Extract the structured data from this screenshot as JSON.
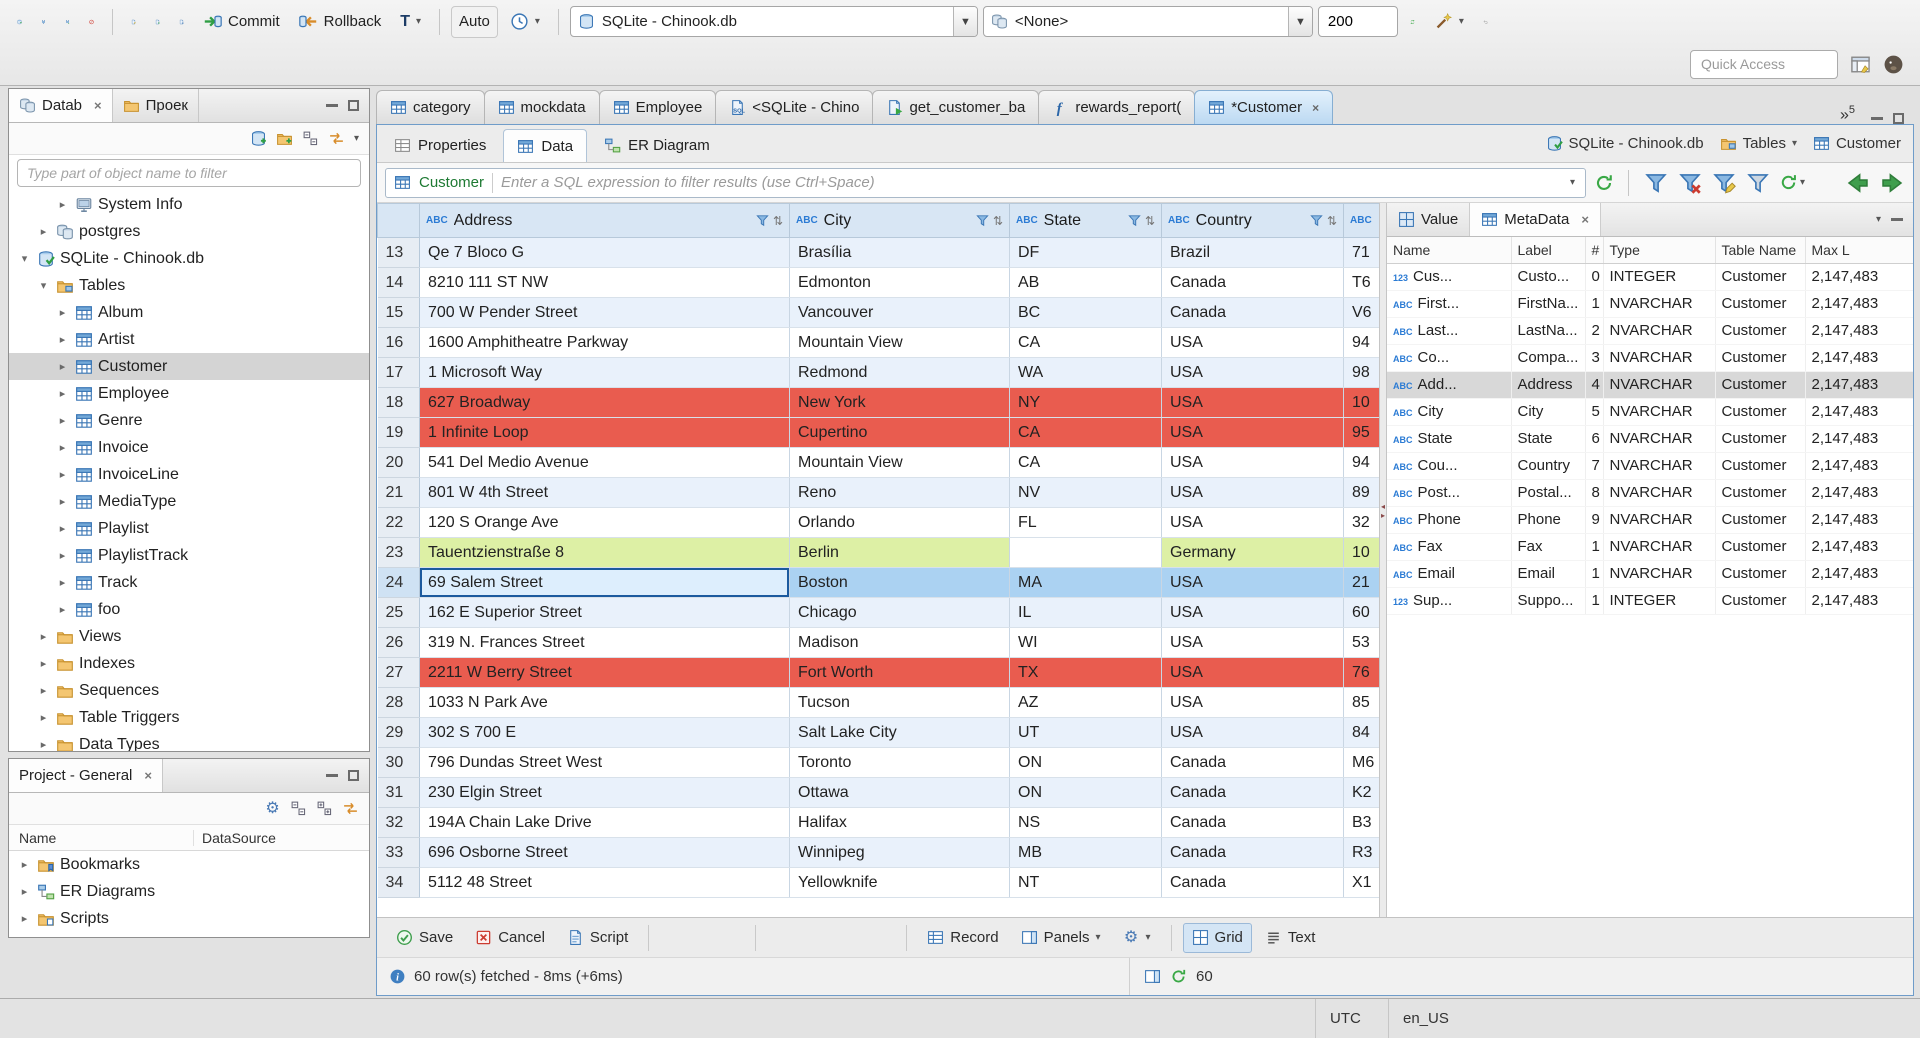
{
  "window": {
    "statusbar": {
      "timezone": "UTC",
      "locale": "en_US"
    }
  },
  "toolbar": {
    "commit_label": "Commit",
    "rollback_label": "Rollback",
    "txn_letter": "T",
    "auto_label": "Auto",
    "connection_value": "SQLite - Chinook.db",
    "schema_value": "<None>",
    "fetch_size_value": "200",
    "quick_access_placeholder": "Quick Access"
  },
  "navigator": {
    "tabs": [
      {
        "label": "Datab"
      },
      {
        "label": "Проек"
      }
    ],
    "filter_placeholder": "Type part of object name to filter",
    "tree": [
      {
        "label": "System Info",
        "icon": "server-icon",
        "indent": 2,
        "arrow": "collapsed"
      },
      {
        "label": "postgres",
        "icon": "db-multi-icon",
        "indent": 1,
        "arrow": "collapsed"
      },
      {
        "label": "SQLite - Chinook.db",
        "icon": "db-connected-icon",
        "indent": 0,
        "arrow": "expanded"
      },
      {
        "label": "Tables",
        "icon": "folder-tables-icon",
        "indent": 1,
        "arrow": "expanded"
      },
      {
        "label": "Album",
        "icon": "table-icon",
        "indent": 2,
        "arrow": "collapsed"
      },
      {
        "label": "Artist",
        "icon": "table-icon",
        "indent": 2,
        "arrow": "collapsed"
      },
      {
        "label": "Customer",
        "icon": "table-icon",
        "indent": 2,
        "arrow": "collapsed",
        "selected": true
      },
      {
        "label": "Employee",
        "icon": "table-icon",
        "indent": 2,
        "arrow": "collapsed"
      },
      {
        "label": "Genre",
        "icon": "table-icon",
        "indent": 2,
        "arrow": "collapsed"
      },
      {
        "label": "Invoice",
        "icon": "table-icon",
        "indent": 2,
        "arrow": "collapsed"
      },
      {
        "label": "InvoiceLine",
        "icon": "table-icon",
        "indent": 2,
        "arrow": "collapsed"
      },
      {
        "label": "MediaType",
        "icon": "table-icon",
        "indent": 2,
        "arrow": "collapsed"
      },
      {
        "label": "Playlist",
        "icon": "table-icon",
        "indent": 2,
        "arrow": "collapsed"
      },
      {
        "label": "PlaylistTrack",
        "icon": "table-icon",
        "indent": 2,
        "arrow": "collapsed"
      },
      {
        "label": "Track",
        "icon": "table-icon",
        "indent": 2,
        "arrow": "collapsed"
      },
      {
        "label": "foo",
        "icon": "table-icon",
        "indent": 2,
        "arrow": "collapsed"
      },
      {
        "label": "Views",
        "icon": "folder-icon",
        "indent": 1,
        "arrow": "collapsed"
      },
      {
        "label": "Indexes",
        "icon": "folder-icon",
        "indent": 1,
        "arrow": "collapsed"
      },
      {
        "label": "Sequences",
        "icon": "folder-icon",
        "indent": 1,
        "arrow": "collapsed"
      },
      {
        "label": "Table Triggers",
        "icon": "folder-icon",
        "indent": 1,
        "arrow": "collapsed"
      },
      {
        "label": "Data Types",
        "icon": "folder-icon",
        "indent": 1,
        "arrow": "collapsed"
      }
    ]
  },
  "project": {
    "title": "Project - General",
    "columns": [
      "Name",
      "DataSource"
    ],
    "items": [
      {
        "label": "Bookmarks",
        "icon": "folder-bookmarks-icon"
      },
      {
        "label": "ER Diagrams",
        "icon": "er-diagrams-icon"
      },
      {
        "label": "Scripts",
        "icon": "folder-scripts-icon"
      }
    ]
  },
  "editor_tabs": {
    "overflow_count": "5",
    "tabs": [
      {
        "label": "category",
        "icon": "table-icon"
      },
      {
        "label": "mockdata",
        "icon": "table-icon"
      },
      {
        "label": "Employee",
        "icon": "table-icon"
      },
      {
        "label": "<SQLite - Chino",
        "icon": "sql-icon"
      },
      {
        "label": "get_customer_ba",
        "icon": "sql-exec-icon"
      },
      {
        "label": "rewards_report(",
        "icon": "function-icon"
      },
      {
        "label": "*Customer",
        "icon": "table-icon",
        "active": true,
        "closable": true
      }
    ]
  },
  "result_tabs": [
    {
      "label": "Properties"
    },
    {
      "label": "Data"
    },
    {
      "label": "ER Diagram"
    }
  ],
  "context_bar": {
    "connection": "SQLite - Chinook.db",
    "container": "Tables",
    "entity": "Customer"
  },
  "filter": {
    "table_label": "Customer",
    "placeholder": "Enter a SQL expression to filter results (use Ctrl+Space)"
  },
  "grid": {
    "columns": [
      {
        "label": "Address",
        "type_icon": "ABC"
      },
      {
        "label": "City",
        "type_icon": "ABC"
      },
      {
        "label": "State",
        "type_icon": "ABC"
      },
      {
        "label": "Country",
        "type_icon": "ABC"
      },
      {
        "label": "",
        "type_icon": "ABC"
      }
    ],
    "rows": [
      {
        "num": "13",
        "cells": [
          "Qe 7 Bloco G",
          "Brasília",
          "DF",
          "Brazil",
          "71"
        ]
      },
      {
        "num": "14",
        "cells": [
          "8210 111 ST NW",
          "Edmonton",
          "AB",
          "Canada",
          "T6"
        ]
      },
      {
        "num": "15",
        "cells": [
          "700 W Pender Street",
          "Vancouver",
          "BC",
          "Canada",
          "V6"
        ]
      },
      {
        "num": "16",
        "cells": [
          "1600 Amphitheatre Parkway",
          "Mountain View",
          "CA",
          "USA",
          "94"
        ]
      },
      {
        "num": "17",
        "cells": [
          "1 Microsoft Way",
          "Redmond",
          "WA",
          "USA",
          "98"
        ]
      },
      {
        "num": "18",
        "hl": "red",
        "cells": [
          "627 Broadway",
          "New York",
          "NY",
          "USA",
          "10"
        ]
      },
      {
        "num": "19",
        "hl": "red",
        "cells": [
          "1 Infinite Loop",
          "Cupertino",
          "CA",
          "USA",
          "95"
        ]
      },
      {
        "num": "20",
        "cells": [
          "541 Del Medio Avenue",
          "Mountain View",
          "CA",
          "USA",
          "94"
        ]
      },
      {
        "num": "21",
        "cells": [
          "801 W 4th Street",
          "Reno",
          "NV",
          "USA",
          "89"
        ]
      },
      {
        "num": "22",
        "cells": [
          "120 S Orange Ave",
          "Orlando",
          "FL",
          "USA",
          "32"
        ]
      },
      {
        "num": "23",
        "hl": "green",
        "cells": [
          "Tauentzienstraße 8",
          "Berlin",
          "",
          "Germany",
          "10"
        ]
      },
      {
        "num": "24",
        "hl": "selected",
        "focus_col": 0,
        "cells": [
          "69 Salem Street",
          "Boston",
          "MA",
          "USA",
          "21"
        ]
      },
      {
        "num": "25",
        "cells": [
          "162 E Superior Street",
          "Chicago",
          "IL",
          "USA",
          "60"
        ]
      },
      {
        "num": "26",
        "cells": [
          "319 N. Frances Street",
          "Madison",
          "WI",
          "USA",
          "53"
        ]
      },
      {
        "num": "27",
        "hl": "red",
        "cells": [
          "2211 W Berry Street",
          "Fort Worth",
          "TX",
          "USA",
          "76"
        ]
      },
      {
        "num": "28",
        "cells": [
          "1033 N Park Ave",
          "Tucson",
          "AZ",
          "USA",
          "85"
        ]
      },
      {
        "num": "29",
        "cells": [
          "302 S 700 E",
          "Salt Lake City",
          "UT",
          "USA",
          "84"
        ]
      },
      {
        "num": "30",
        "cells": [
          "796 Dundas Street West",
          "Toronto",
          "ON",
          "Canada",
          "M6"
        ]
      },
      {
        "num": "31",
        "cells": [
          "230 Elgin Street",
          "Ottawa",
          "ON",
          "Canada",
          "K2"
        ]
      },
      {
        "num": "32",
        "cells": [
          "194A Chain Lake Drive",
          "Halifax",
          "NS",
          "Canada",
          "B3"
        ]
      },
      {
        "num": "33",
        "cells": [
          "696 Osborne Street",
          "Winnipeg",
          "MB",
          "Canada",
          "R3"
        ]
      },
      {
        "num": "34",
        "cells": [
          "5112 48 Street",
          "Yellowknife",
          "NT",
          "Canada",
          "X1"
        ]
      }
    ]
  },
  "panel": {
    "tabs": [
      {
        "label": "Value"
      },
      {
        "label": "MetaData"
      }
    ],
    "columns": [
      "Name",
      "Label",
      "#",
      "Type",
      "Table Name",
      "Max L"
    ],
    "rows": [
      {
        "icon": "123",
        "name": "Cus...",
        "label": "Custo...",
        "num": "0",
        "type": "INTEGER",
        "table": "Customer",
        "max": "2,147,483"
      },
      {
        "icon": "ABC",
        "name": "First...",
        "label": "FirstNa...",
        "num": "1",
        "type": "NVARCHAR",
        "table": "Customer",
        "max": "2,147,483"
      },
      {
        "icon": "ABC",
        "name": "Last...",
        "label": "LastNa...",
        "num": "2",
        "type": "NVARCHAR",
        "table": "Customer",
        "max": "2,147,483"
      },
      {
        "icon": "ABC",
        "name": "Co...",
        "label": "Compa...",
        "num": "3",
        "type": "NVARCHAR",
        "table": "Customer",
        "max": "2,147,483"
      },
      {
        "icon": "ABC",
        "name": "Add...",
        "label": "Address",
        "num": "4",
        "type": "NVARCHAR",
        "table": "Customer",
        "max": "2,147,483",
        "selected": true
      },
      {
        "icon": "ABC",
        "name": "City",
        "label": "City",
        "num": "5",
        "type": "NVARCHAR",
        "table": "Customer",
        "max": "2,147,483"
      },
      {
        "icon": "ABC",
        "name": "State",
        "label": "State",
        "num": "6",
        "type": "NVARCHAR",
        "table": "Customer",
        "max": "2,147,483"
      },
      {
        "icon": "ABC",
        "name": "Cou...",
        "label": "Country",
        "num": "7",
        "type": "NVARCHAR",
        "table": "Customer",
        "max": "2,147,483"
      },
      {
        "icon": "ABC",
        "name": "Post...",
        "label": "Postal...",
        "num": "8",
        "type": "NVARCHAR",
        "table": "Customer",
        "max": "2,147,483"
      },
      {
        "icon": "ABC",
        "name": "Phone",
        "label": "Phone",
        "num": "9",
        "type": "NVARCHAR",
        "table": "Customer",
        "max": "2,147,483"
      },
      {
        "icon": "ABC",
        "name": "Fax",
        "label": "Fax",
        "num": "1",
        "type": "NVARCHAR",
        "table": "Customer",
        "max": "2,147,483"
      },
      {
        "icon": "ABC",
        "name": "Email",
        "label": "Email",
        "num": "1",
        "type": "NVARCHAR",
        "table": "Customer",
        "max": "2,147,483"
      },
      {
        "icon": "123",
        "name": "Sup...",
        "label": "Suppo...",
        "num": "1",
        "type": "INTEGER",
        "table": "Customer",
        "max": "2,147,483"
      }
    ]
  },
  "bottom_toolbar": {
    "save_label": "Save",
    "cancel_label": "Cancel",
    "script_label": "Script",
    "record_label": "Record",
    "panels_label": "Panels",
    "grid_label": "Grid",
    "text_label": "Text"
  },
  "status": {
    "message": "60 row(s) fetched - 8ms (+6ms)",
    "refresh_value": "60"
  }
}
